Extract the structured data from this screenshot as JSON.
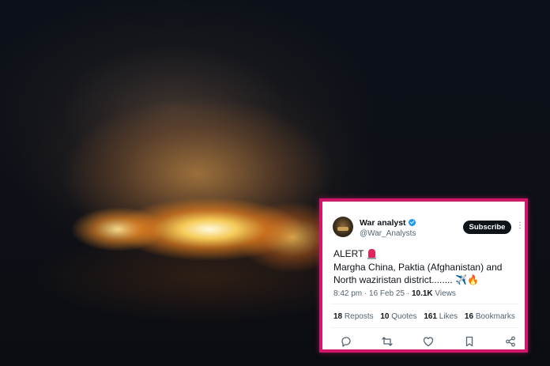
{
  "tweet": {
    "display_name": "War analyst",
    "handle": "@War_Analysts",
    "subscribe_label": "Subscribe",
    "more_label": "⋮",
    "alert_line": "ALERT",
    "body_line_2": "Margha China, Paktia (Afghanistan) and",
    "body_line_3": "North waziristan district........ ✈️🔥",
    "time_date": "8:42 pm · 16 Feb 25 · ",
    "views_count": "10.1K",
    "views_label": " Views",
    "stats": {
      "reposts_count": "18",
      "reposts_label": "Reposts",
      "quotes_count": "10",
      "quotes_label": "Quotes",
      "likes_count": "161",
      "likes_label": "Likes",
      "bookmarks_count": "16",
      "bookmarks_label": "Bookmarks"
    },
    "actions": [
      "reply-icon",
      "repost-icon",
      "like-icon",
      "bookmark-icon",
      "share-icon"
    ]
  },
  "colors": {
    "frame_border": "#d0186a",
    "verified_badge": "#1d9bf0",
    "subscribe_bg": "#0f1419",
    "muted_text": "#536471"
  }
}
